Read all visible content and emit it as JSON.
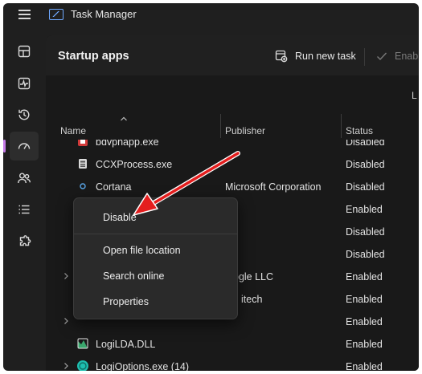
{
  "app": {
    "title": "Task Manager"
  },
  "nav": {
    "items": [
      {
        "name": "processes",
        "icon": "grid-icon"
      },
      {
        "name": "performance",
        "icon": "activity-icon"
      },
      {
        "name": "app-history",
        "icon": "history-icon"
      },
      {
        "name": "startup-apps",
        "icon": "speedometer-icon",
        "active": true
      },
      {
        "name": "users",
        "icon": "users-icon"
      },
      {
        "name": "details",
        "icon": "list-icon"
      },
      {
        "name": "services",
        "icon": "puzzle-icon"
      }
    ]
  },
  "header": {
    "title": "Startup apps",
    "run_new_task": "Run new task",
    "enable": "Enab",
    "info_text": "L"
  },
  "columns": {
    "name": "Name",
    "publisher": "Publisher",
    "status": "Status"
  },
  "rows": [
    {
      "name": "bdvphapp.exe",
      "publisher": "",
      "status": "Disabled",
      "icon": "app-red-icon"
    },
    {
      "name": "CCXProcess.exe",
      "publisher": "",
      "status": "Disabled",
      "icon": "app-gray-icon"
    },
    {
      "name": "Cortana",
      "publisher": "Microsoft Corporation",
      "status": "Disabled",
      "icon": "cortana-icon"
    },
    {
      "name": "",
      "publisher": "",
      "status": "Enabled",
      "icon": ""
    },
    {
      "name": "",
      "publisher": "",
      "status": "Disabled",
      "icon": ""
    },
    {
      "name": "",
      "publisher": "",
      "status": "Disabled",
      "icon": ""
    },
    {
      "name": "",
      "publisher": "ogle LLC",
      "status": "Enabled",
      "icon": "",
      "expandable": true
    },
    {
      "name": "",
      "publisher": "itech",
      "status": "Enabled",
      "icon": ""
    },
    {
      "name": "",
      "publisher": "",
      "status": "Enabled",
      "icon": "",
      "expandable": true
    },
    {
      "name": "LogiLDA.DLL",
      "publisher": "",
      "status": "Enabled",
      "icon": "logi-lda-icon"
    },
    {
      "name": "LogiOptions.exe (14)",
      "publisher": "",
      "status": "Enabled",
      "icon": "logi-options-icon",
      "expandable": true
    }
  ],
  "context_menu": {
    "items": [
      "Disable",
      "Open file location",
      "Search online",
      "Properties"
    ]
  },
  "colors": {
    "window_bg": "#1f1f1f",
    "content_bg": "#191919",
    "accent": "#c47ae6",
    "annotation": "#e41e1e"
  }
}
